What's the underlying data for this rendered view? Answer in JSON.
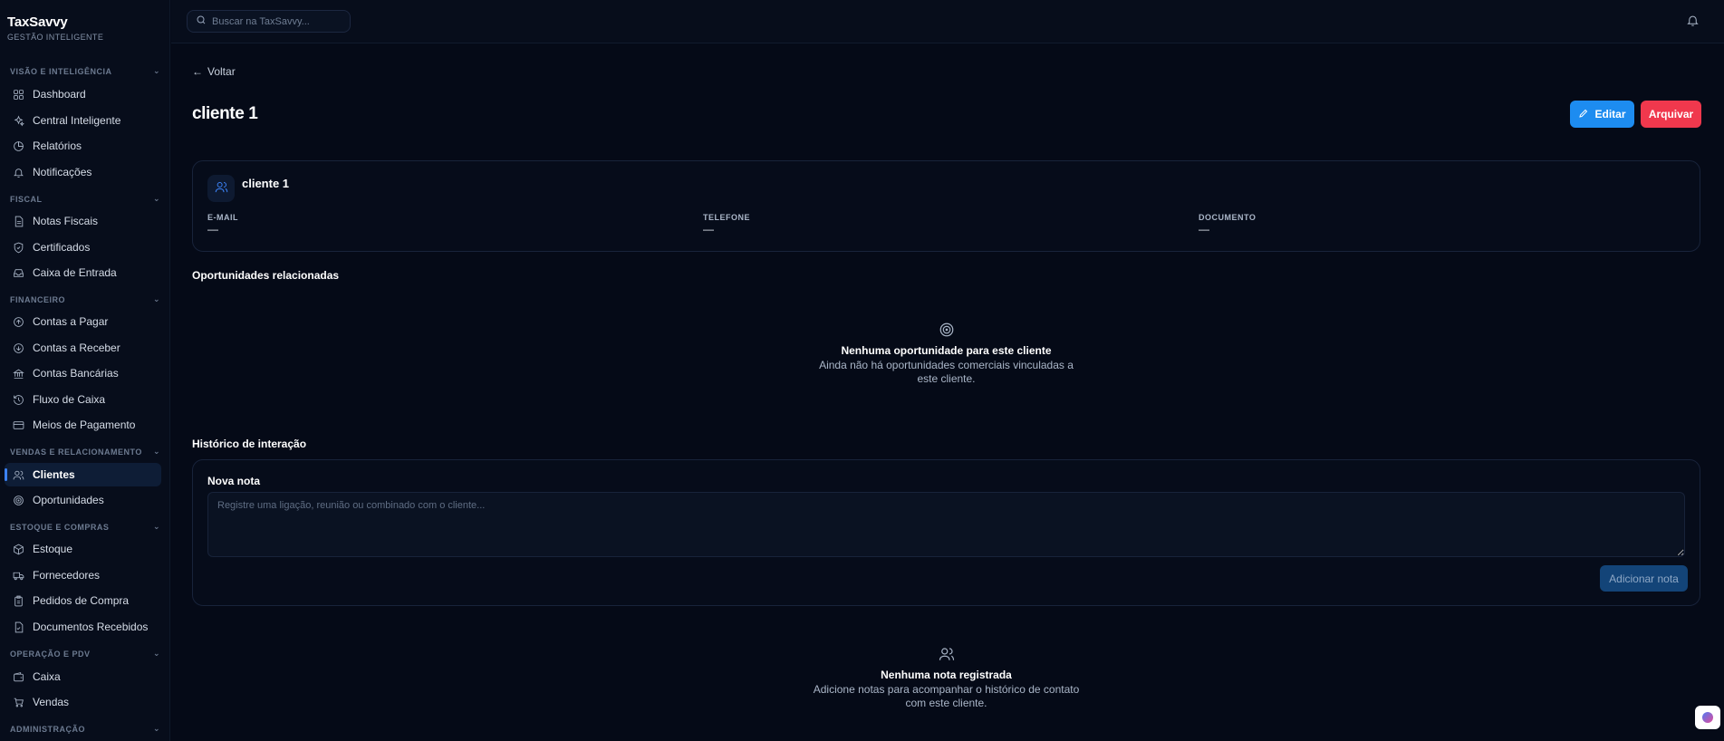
{
  "brand": {
    "name": "TaxSavvy",
    "subtitle": "GESTÃO INTELIGENTE"
  },
  "sidebar": {
    "sections": [
      {
        "title": "VISÃO E INTELIGÊNCIA",
        "items": [
          {
            "label": "Dashboard",
            "icon": "grid-icon"
          },
          {
            "label": "Central Inteligente",
            "icon": "sparkles-icon"
          },
          {
            "label": "Relatórios",
            "icon": "pie-chart-icon"
          },
          {
            "label": "Notificações",
            "icon": "bell-icon"
          }
        ]
      },
      {
        "title": "FISCAL",
        "items": [
          {
            "label": "Notas Fiscais",
            "icon": "file-text-icon"
          },
          {
            "label": "Certificados",
            "icon": "shield-icon"
          },
          {
            "label": "Caixa de Entrada",
            "icon": "inbox-icon"
          }
        ]
      },
      {
        "title": "FINANCEIRO",
        "items": [
          {
            "label": "Contas a Pagar",
            "icon": "arrow-up-circle-icon"
          },
          {
            "label": "Contas a Receber",
            "icon": "arrow-down-circle-icon"
          },
          {
            "label": "Contas Bancárias",
            "icon": "bank-icon"
          },
          {
            "label": "Fluxo de Caixa",
            "icon": "history-icon"
          },
          {
            "label": "Meios de Pagamento",
            "icon": "credit-card-icon"
          }
        ]
      },
      {
        "title": "VENDAS E RELACIONAMENTO",
        "items": [
          {
            "label": "Clientes",
            "icon": "users-icon",
            "active": true
          },
          {
            "label": "Oportunidades",
            "icon": "target-icon"
          }
        ]
      },
      {
        "title": "ESTOQUE E COMPRAS",
        "items": [
          {
            "label": "Estoque",
            "icon": "box-icon"
          },
          {
            "label": "Fornecedores",
            "icon": "truck-icon"
          },
          {
            "label": "Pedidos de Compra",
            "icon": "clipboard-icon"
          },
          {
            "label": "Documentos Recebidos",
            "icon": "file-check-icon"
          }
        ]
      },
      {
        "title": "OPERAÇÃO E PDV",
        "items": [
          {
            "label": "Caixa",
            "icon": "wallet-icon"
          },
          {
            "label": "Vendas",
            "icon": "cart-icon"
          }
        ]
      },
      {
        "title": "ADMINISTRAÇÃO",
        "items": []
      }
    ]
  },
  "topbar": {
    "search_placeholder": "Buscar na TaxSavvy..."
  },
  "page": {
    "back_label": "Voltar",
    "title": "cliente 1",
    "edit_label": "Editar",
    "archive_label": "Arquivar"
  },
  "client": {
    "name": "cliente 1",
    "fields": [
      {
        "label": "E-MAIL",
        "value": "—"
      },
      {
        "label": "TELEFONE",
        "value": "—"
      },
      {
        "label": "DOCUMENTO",
        "value": "—"
      }
    ]
  },
  "opportunities": {
    "heading": "Oportunidades relacionadas",
    "empty_title": "Nenhuma oportunidade para este cliente",
    "empty_desc": "Ainda não há oportunidades comerciais vinculadas a este cliente."
  },
  "history": {
    "heading": "Histórico de interação",
    "new_note_label": "Nova nota",
    "note_placeholder": "Registre uma ligação, reunião ou combinado com o cliente...",
    "add_note_label": "Adicionar nota",
    "empty_title": "Nenhuma nota registrada",
    "empty_desc": "Adicione notas para acompanhar o histórico de contato com este cliente."
  },
  "colors": {
    "accent": "#1d8cf0",
    "danger": "#f0384d",
    "background": "#050a17"
  }
}
